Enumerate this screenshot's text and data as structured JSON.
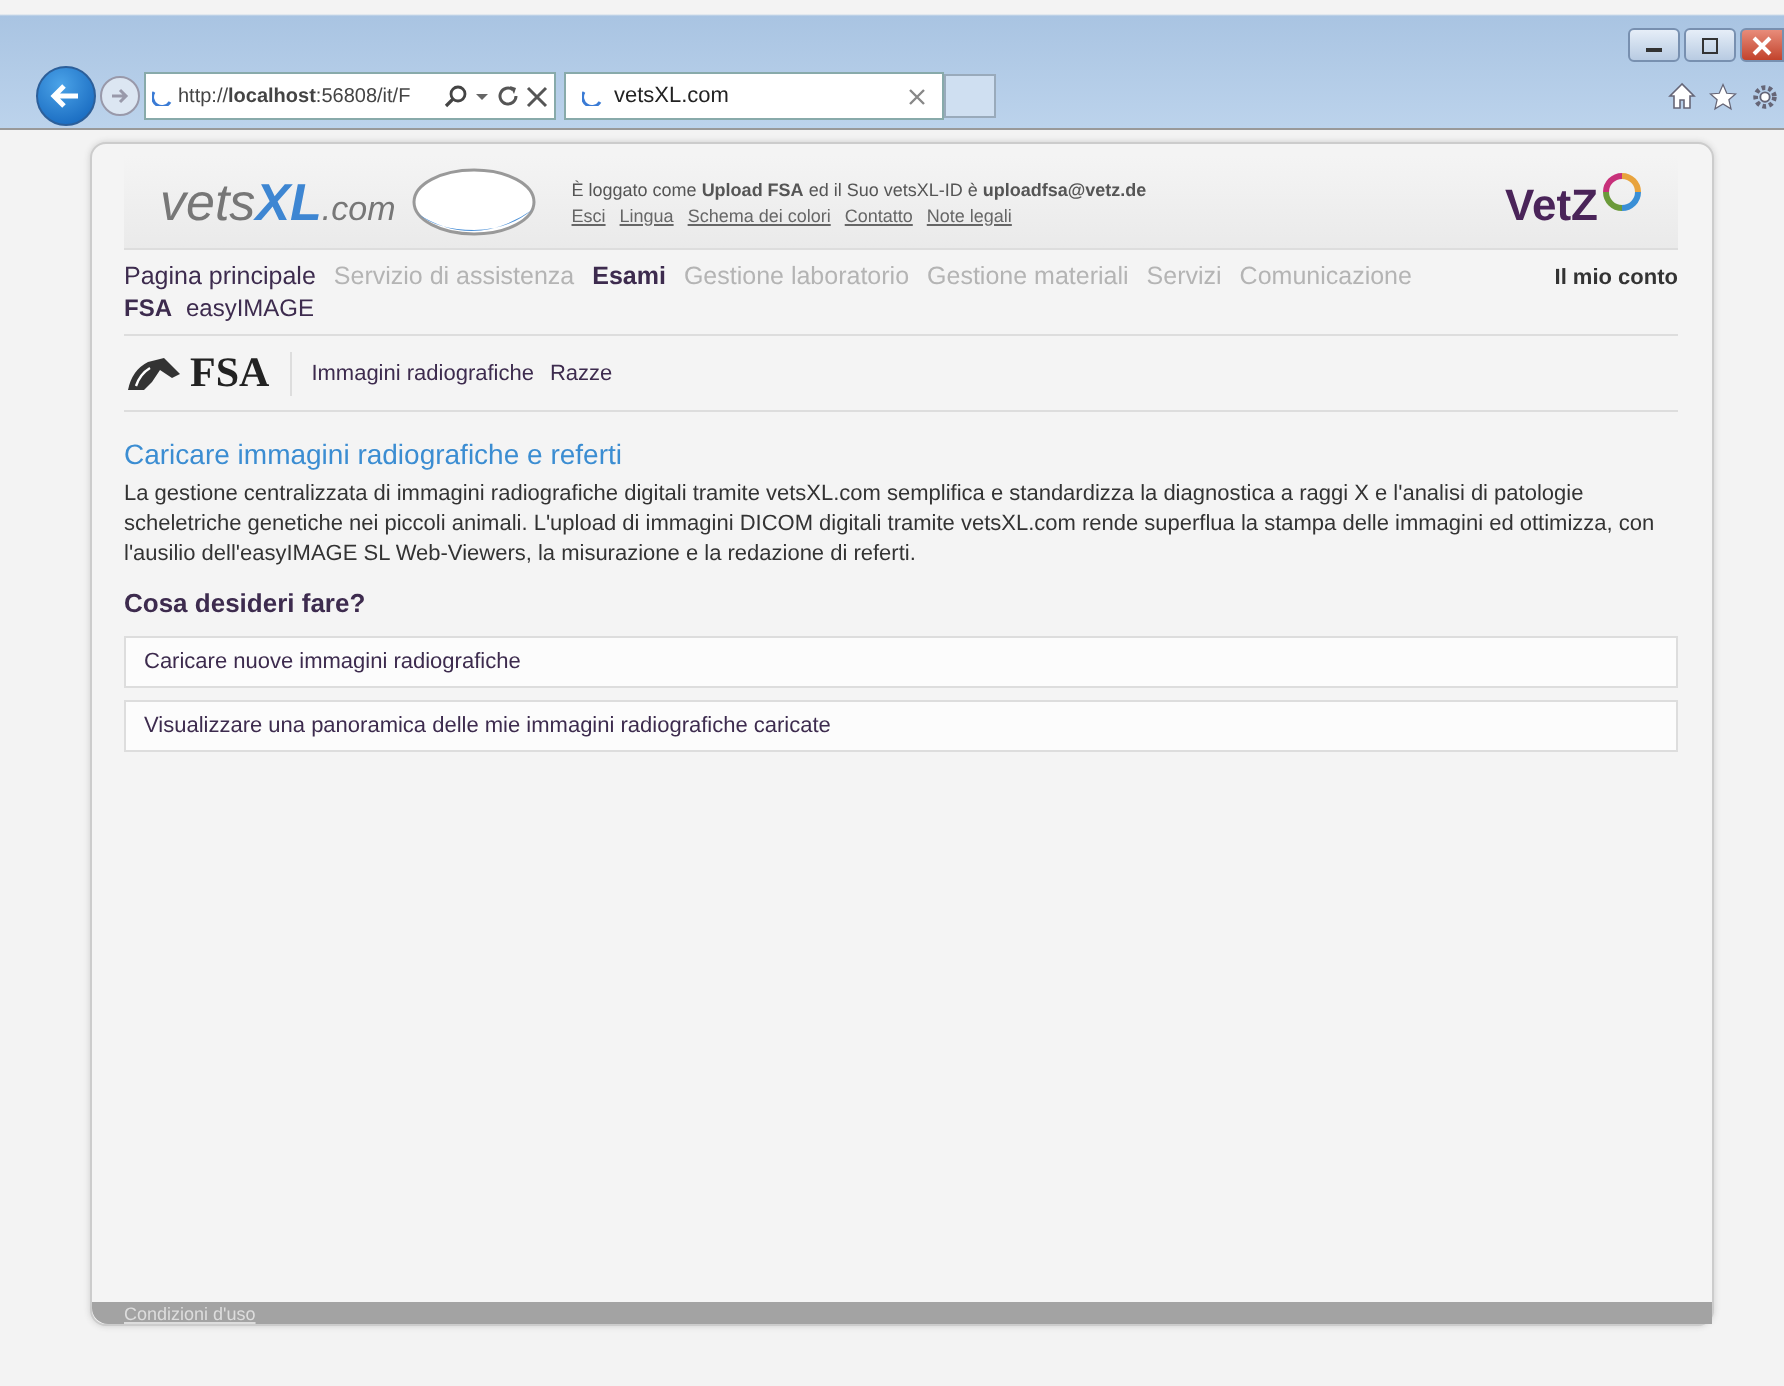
{
  "browser": {
    "address": "http://**localhost**:56808/it/F",
    "tab_title": "vetsXL.com"
  },
  "header": {
    "logo_prefix": "vets",
    "logo_bold": "XL",
    "logo_suffix": ".com",
    "login_text": "È loggato come **Upload FSA** ed il Suo vetsXL-ID è **uploadfsa@vetz.de**",
    "links": [
      "Esci",
      "Lingua",
      "Schema dei colori",
      "Contatto",
      "Note legali"
    ],
    "brand": "VetZ"
  },
  "main_nav": [
    {
      "label": "Pagina principale",
      "selected": false,
      "disabled": false
    },
    {
      "label": "Servizio di assistenza",
      "selected": false,
      "disabled": true
    },
    {
      "label": "Esami",
      "selected": true,
      "disabled": false
    },
    {
      "label": "Gestione laboratorio",
      "selected": false,
      "disabled": true
    },
    {
      "label": "Gestione materiali",
      "selected": false,
      "disabled": true
    },
    {
      "label": "Servizi",
      "selected": false,
      "disabled": true
    },
    {
      "label": "Comunicazione",
      "selected": false,
      "disabled": true
    }
  ],
  "account_link": "Il mio conto",
  "sub_nav": [
    "FSA",
    "easyIMAGE"
  ],
  "section_logo": "FSA",
  "section_nav": [
    "Immagini radiografiche",
    "Razze"
  ],
  "title": "Caricare immagini radiografiche e referti",
  "description": "La gestione centralizzata di immagini radiografiche digitali tramite vetsXL.com semplifica e standardizza la diagnostica a raggi X e l'analisi di patologie scheletriche genetiche nei piccoli animali. L'upload di immagini DICOM digitali tramite vetsXL.com rende superflua la stampa delle immagini ed ottimizza, con l'ausilio dell'easyIMAGE SL Web-Viewers, la misurazione e la redazione di referti.",
  "question": "Cosa desideri fare?",
  "actions": [
    "Caricare nuove immagini radiografiche",
    "Visualizzare una panoramica delle mie immagini radiografiche caricate"
  ],
  "footer_link": "Condizioni d'uso"
}
